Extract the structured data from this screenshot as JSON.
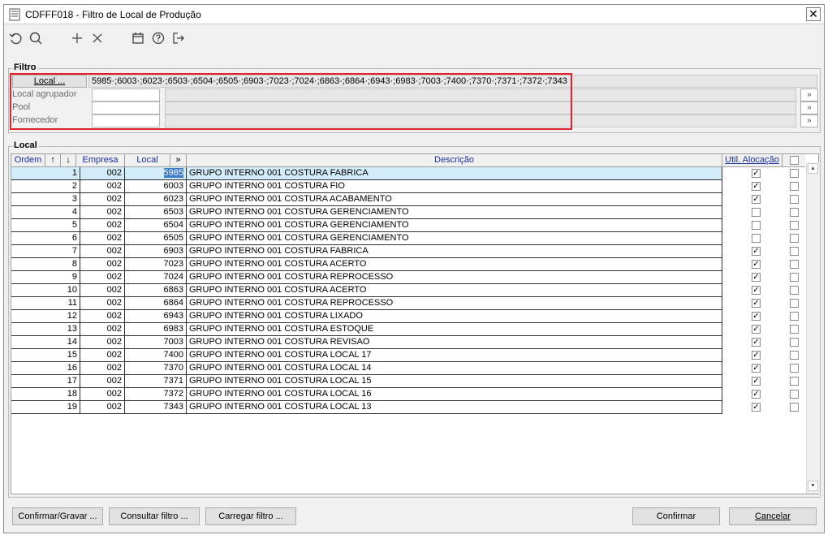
{
  "window": {
    "title": "CDFFF018 - Filtro de Local de Produção",
    "close_glyph": "✕"
  },
  "toolbar": {
    "icons": [
      "refresh-icon",
      "search-icon",
      "add-icon",
      "delete-icon",
      "calendar-icon",
      "help-icon",
      "exit-icon"
    ]
  },
  "filtro": {
    "legend": "Filtro",
    "local_button": "Local ...",
    "local_value": "5985·;6003·;6023·;6503·;6504·;6505·;6903·;7023·;7024·;6863·;6864·;6943·;6983·;7003·;7400·;7370·;7371·;7372·;7343",
    "local_agrupador_label": "Local agrupador",
    "pool_label": "Pool",
    "fornecedor_label": "Fornecedor",
    "search_glyph": "»"
  },
  "local_group": {
    "legend": "Local",
    "headers": {
      "ordem": "Ordem",
      "up": "↑",
      "down": "↓",
      "empresa": "Empresa",
      "local": "Local",
      "expand": "»",
      "descricao": "Descrição",
      "util_alocacao": "Util. Alocação"
    },
    "rows": [
      {
        "ordem": "1",
        "empresa": "002",
        "local": "5985",
        "descricao": "GRUPO INTERNO 001 COSTURA FABRICA",
        "util": true,
        "sel": false
      },
      {
        "ordem": "2",
        "empresa": "002",
        "local": "6003",
        "descricao": "GRUPO INTERNO 001 COSTURA FIO",
        "util": true,
        "sel": false
      },
      {
        "ordem": "3",
        "empresa": "002",
        "local": "6023",
        "descricao": "GRUPO INTERNO 001 COSTURA ACABAMENTO",
        "util": true,
        "sel": false
      },
      {
        "ordem": "4",
        "empresa": "002",
        "local": "6503",
        "descricao": "GRUPO INTERNO 001 COSTURA GERENCIAMENTO",
        "util": false,
        "sel": false
      },
      {
        "ordem": "5",
        "empresa": "002",
        "local": "6504",
        "descricao": "GRUPO INTERNO 001 COSTURA GERENCIAMENTO",
        "util": false,
        "sel": false
      },
      {
        "ordem": "6",
        "empresa": "002",
        "local": "6505",
        "descricao": "GRUPO INTERNO 001 COSTURA GERENCIAMENTO",
        "util": false,
        "sel": false
      },
      {
        "ordem": "7",
        "empresa": "002",
        "local": "6903",
        "descricao": "GRUPO INTERNO 001 COSTURA FABRICA",
        "util": true,
        "sel": false
      },
      {
        "ordem": "8",
        "empresa": "002",
        "local": "7023",
        "descricao": "GRUPO INTERNO 001 COSTURA ACERTO",
        "util": true,
        "sel": false
      },
      {
        "ordem": "9",
        "empresa": "002",
        "local": "7024",
        "descricao": "GRUPO INTERNO 001 COSTURA REPROCESSO",
        "util": true,
        "sel": false
      },
      {
        "ordem": "10",
        "empresa": "002",
        "local": "6863",
        "descricao": "GRUPO INTERNO 001 COSTURA ACERTO",
        "util": true,
        "sel": false
      },
      {
        "ordem": "11",
        "empresa": "002",
        "local": "6864",
        "descricao": "GRUPO INTERNO 001 COSTURA REPROCESSO",
        "util": true,
        "sel": false
      },
      {
        "ordem": "12",
        "empresa": "002",
        "local": "6943",
        "descricao": "GRUPO INTERNO 001 COSTURA LIXADO",
        "util": true,
        "sel": false
      },
      {
        "ordem": "13",
        "empresa": "002",
        "local": "6983",
        "descricao": "GRUPO INTERNO 001 COSTURA ESTOQUE",
        "util": true,
        "sel": false
      },
      {
        "ordem": "14",
        "empresa": "002",
        "local": "7003",
        "descricao": "GRUPO INTERNO 001 COSTURA REVISAO",
        "util": true,
        "sel": false
      },
      {
        "ordem": "15",
        "empresa": "002",
        "local": "7400",
        "descricao": "GRUPO INTERNO 001 COSTURA LOCAL 17",
        "util": true,
        "sel": false
      },
      {
        "ordem": "16",
        "empresa": "002",
        "local": "7370",
        "descricao": "GRUPO INTERNO 001 COSTURA LOCAL 14",
        "util": true,
        "sel": false
      },
      {
        "ordem": "17",
        "empresa": "002",
        "local": "7371",
        "descricao": "GRUPO INTERNO 001 COSTURA LOCAL 15",
        "util": true,
        "sel": false
      },
      {
        "ordem": "18",
        "empresa": "002",
        "local": "7372",
        "descricao": "GRUPO INTERNO 001 COSTURA LOCAL 16",
        "util": true,
        "sel": false
      },
      {
        "ordem": "19",
        "empresa": "002",
        "local": "7343",
        "descricao": "GRUPO INTERNO 001 COSTURA LOCAL 13",
        "util": true,
        "sel": false
      }
    ]
  },
  "buttons": {
    "confirmar_gravar": "Confirmar/Gravar ...",
    "consultar_filtro": "Consultar filtro ...",
    "carregar_filtro": "Carregar filtro ...",
    "confirmar": "Confirmar",
    "cancelar": "Cancelar"
  },
  "colors": {
    "highlight": "#d3ecf9",
    "header_text": "#1b2ea0",
    "red_box": "#e0202a"
  }
}
